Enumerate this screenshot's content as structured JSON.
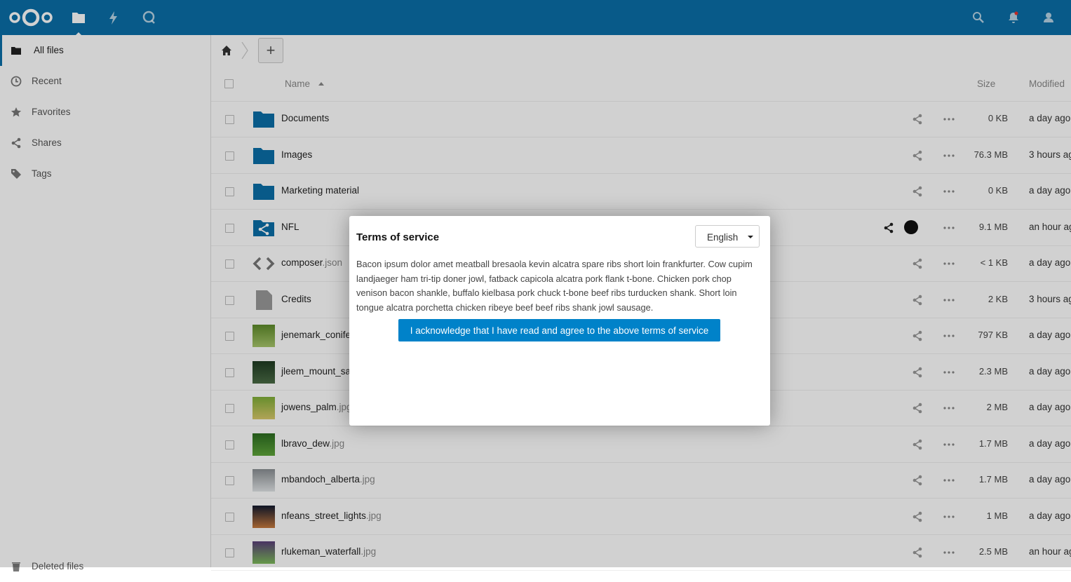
{
  "colors": {
    "header": "#0a6ea8",
    "folder": "#0a6ea8",
    "button": "#0082c9"
  },
  "header": {
    "apps": [
      "files-icon",
      "activity-icon",
      "search-app-icon"
    ],
    "right_icons": [
      "search-icon",
      "notifications-icon",
      "contacts-icon"
    ]
  },
  "sidebar": {
    "items": [
      {
        "label": "All files",
        "icon": "folder-icon"
      },
      {
        "label": "Recent",
        "icon": "clock-icon"
      },
      {
        "label": "Favorites",
        "icon": "star-icon"
      },
      {
        "label": "Shares",
        "icon": "share-icon"
      },
      {
        "label": "Tags",
        "icon": "tag-icon"
      }
    ],
    "deleted_label": "Deleted files"
  },
  "table": {
    "columns": {
      "name": "Name",
      "size": "Size",
      "modified": "Modified"
    },
    "rows": [
      {
        "name": "Documents",
        "ext": "",
        "type": "folder",
        "size": "0 KB",
        "modified": "a day ago"
      },
      {
        "name": "Images",
        "ext": "",
        "type": "folder",
        "size": "76.3 MB",
        "modified": "3 hours ag"
      },
      {
        "name": "Marketing material",
        "ext": "",
        "type": "folder",
        "size": "0 KB",
        "modified": "a day ago"
      },
      {
        "name": "NFL",
        "ext": "",
        "type": "shared-folder",
        "size": "9.1 MB",
        "modified": "an hour ag"
      },
      {
        "name": "composer",
        "ext": ".json",
        "type": "code",
        "size": "< 1 KB",
        "modified": "a day ago"
      },
      {
        "name": "Credits",
        "ext": "",
        "type": "file",
        "size": "2 KB",
        "modified": "3 hours ag"
      },
      {
        "name": "jenemark_conife",
        "ext": "",
        "type": "image",
        "size": "797 KB",
        "modified": "a day ago"
      },
      {
        "name": "jleem_mount_sa",
        "ext": "",
        "type": "image",
        "size": "2.3 MB",
        "modified": "a day ago"
      },
      {
        "name": "jowens_palm",
        "ext": ".jpg",
        "type": "image",
        "size": "2 MB",
        "modified": "a day ago"
      },
      {
        "name": "lbravo_dew",
        "ext": ".jpg",
        "type": "image",
        "size": "1.7 MB",
        "modified": "a day ago"
      },
      {
        "name": "mbandoch_alberta",
        "ext": ".jpg",
        "type": "image",
        "size": "1.7 MB",
        "modified": "a day ago"
      },
      {
        "name": "nfeans_street_lights",
        "ext": ".jpg",
        "type": "image",
        "size": "1 MB",
        "modified": "a day ago"
      },
      {
        "name": "rlukeman_waterfall",
        "ext": ".jpg",
        "type": "image",
        "size": "2.5 MB",
        "modified": "an hour ag"
      }
    ]
  },
  "modal": {
    "title": "Terms of service",
    "language": "English",
    "text": "Bacon ipsum dolor amet meatball bresaola kevin alcatra spare ribs short loin frankfurter. Cow cupim landjaeger ham tri-tip doner jowl, fatback capicola alcatra pork flank t-bone. Chicken pork chop venison bacon shankle, buffalo kielbasa pork chuck t-bone beef ribs turducken shank. Short loin tongue alcatra porchetta chicken ribeye beef beef ribs shank jowl sausage.",
    "accept_label": "I acknowledge that I have read and agree to the above terms of service"
  }
}
